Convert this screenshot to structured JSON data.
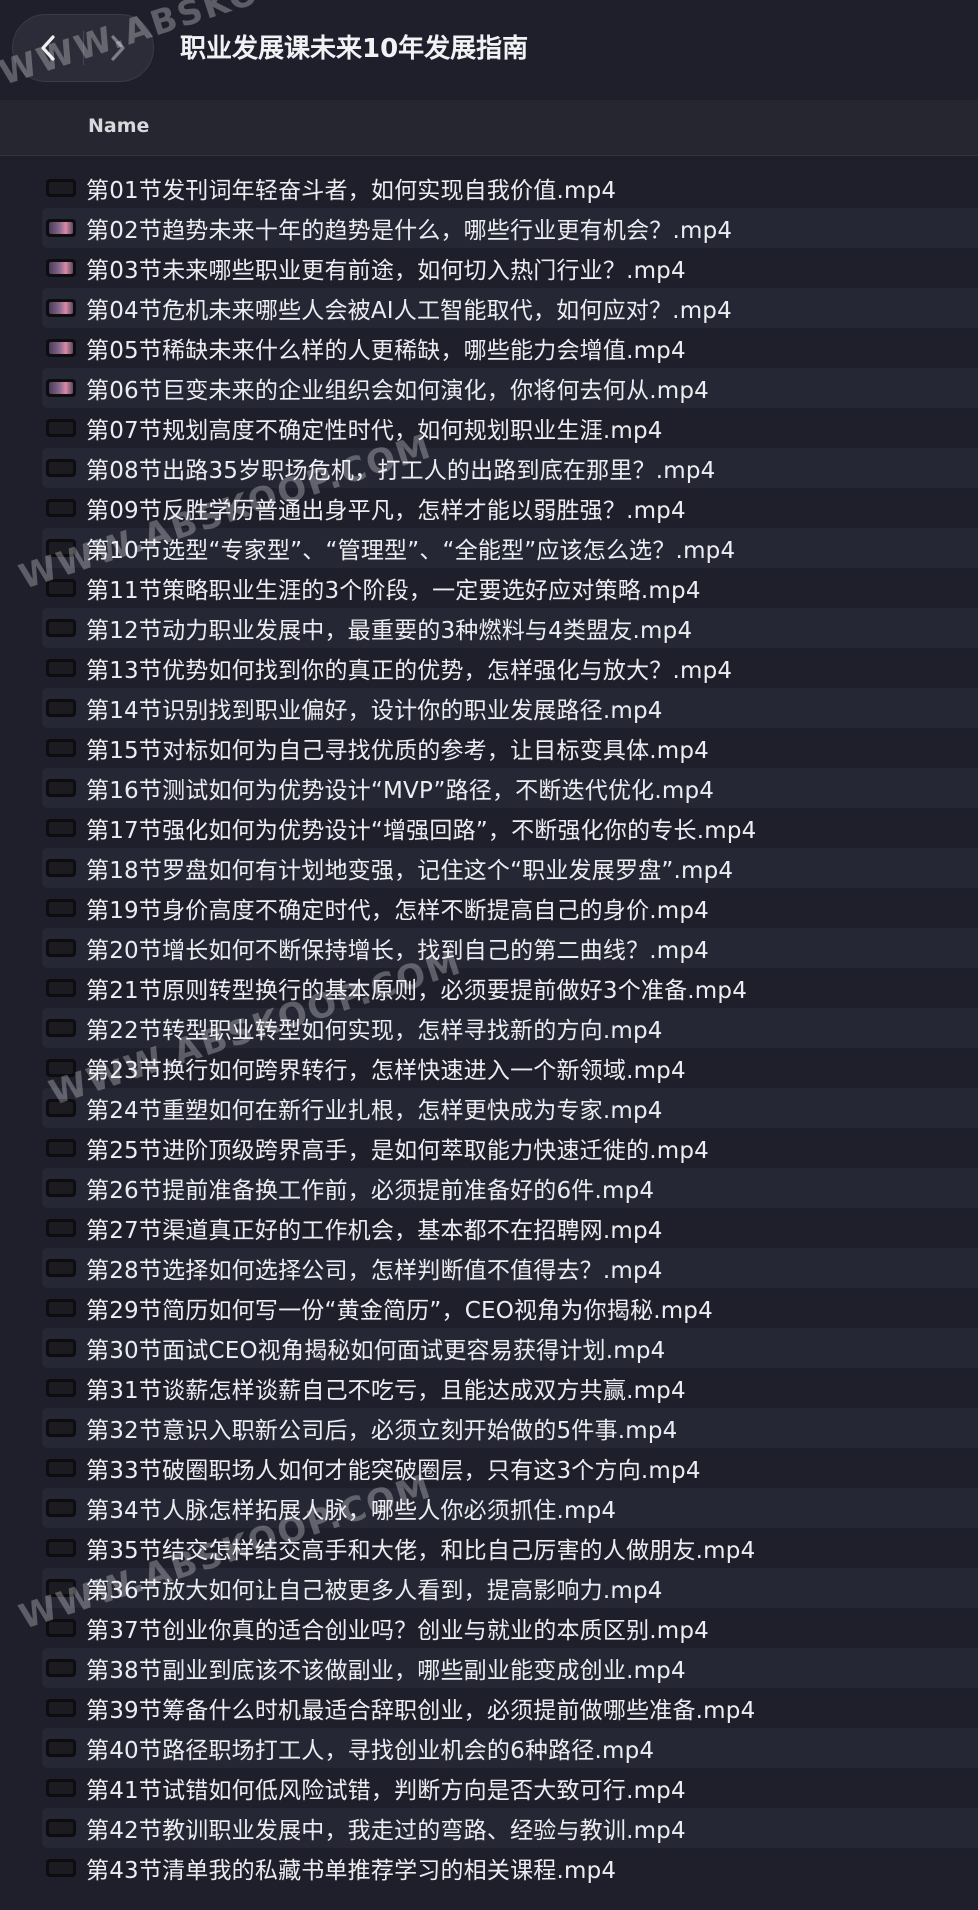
{
  "window": {
    "title": "职业发展课未来10年发展指南"
  },
  "columns": {
    "name": "Name"
  },
  "files": [
    {
      "name": "第01节发刊词年轻奋斗者，如何实现自我价值.mp4",
      "thumb": false
    },
    {
      "name": "第02节趋势未来十年的趋势是什么，哪些行业更有机会？.mp4",
      "thumb": true
    },
    {
      "name": "第03节未来哪些职业更有前途，如何切入热门行业？.mp4",
      "thumb": true
    },
    {
      "name": "第04节危机未来哪些人会被AI人工智能取代，如何应对？.mp4",
      "thumb": true
    },
    {
      "name": "第05节稀缺未来什么样的人更稀缺，哪些能力会增值.mp4",
      "thumb": true
    },
    {
      "name": "第06节巨变未来的企业组织会如何演化，你将何去何从.mp4",
      "thumb": true
    },
    {
      "name": "第07节规划高度不确定性时代，如何规划职业生涯.mp4",
      "thumb": false
    },
    {
      "name": "第08节出路35岁职场危机，打工人的出路到底在那里？.mp4",
      "thumb": false
    },
    {
      "name": "第09节反胜学历普通出身平凡，怎样才能以弱胜强？.mp4",
      "thumb": false
    },
    {
      "name": "第10节选型“专家型”、“管理型”、“全能型”应该怎么选？.mp4",
      "thumb": false
    },
    {
      "name": "第11节策略职业生涯的3个阶段，一定要选好应对策略.mp4",
      "thumb": false
    },
    {
      "name": "第12节动力职业发展中，最重要的3种燃料与4类盟友.mp4",
      "thumb": false
    },
    {
      "name": "第13节优势如何找到你的真正的优势，怎样强化与放大？.mp4",
      "thumb": false
    },
    {
      "name": "第14节识别找到职业偏好，设计你的职业发展路径.mp4",
      "thumb": false
    },
    {
      "name": "第15节对标如何为自己寻找优质的参考，让目标变具体.mp4",
      "thumb": false
    },
    {
      "name": "第16节测试如何为优势设计“MVP”路径，不断迭代优化.mp4",
      "thumb": false
    },
    {
      "name": "第17节强化如何为优势设计“增强回路”，不断强化你的专长.mp4",
      "thumb": false
    },
    {
      "name": "第18节罗盘如何有计划地变强，记住这个“职业发展罗盘”.mp4",
      "thumb": false
    },
    {
      "name": "第19节身价高度不确定时代，怎样不断提高自己的身价.mp4",
      "thumb": false
    },
    {
      "name": "第20节增长如何不断保持增长，找到自己的第二曲线？.mp4",
      "thumb": false
    },
    {
      "name": "第21节原则转型换行的基本原则，必须要提前做好3个准备.mp4",
      "thumb": false
    },
    {
      "name": "第22节转型职业转型如何实现，怎样寻找新的方向.mp4",
      "thumb": false
    },
    {
      "name": "第23节换行如何跨界转行，怎样快速进入一个新领域.mp4",
      "thumb": false
    },
    {
      "name": "第24节重塑如何在新行业扎根，怎样更快成为专家.mp4",
      "thumb": false
    },
    {
      "name": "第25节进阶顶级跨界高手，是如何萃取能力快速迁徙的.mp4",
      "thumb": false
    },
    {
      "name": "第26节提前准备换工作前，必须提前准备好的6件.mp4",
      "thumb": false
    },
    {
      "name": "第27节渠道真正好的工作机会，基本都不在招聘网.mp4",
      "thumb": false
    },
    {
      "name": "第28节选择如何选择公司，怎样判断值不值得去？.mp4",
      "thumb": false
    },
    {
      "name": "第29节简历如何写一份“黄金简历”，CEO视角为你揭秘.mp4",
      "thumb": false
    },
    {
      "name": "第30节面试CEO视角揭秘如何面试更容易获得计划.mp4",
      "thumb": false
    },
    {
      "name": "第31节谈薪怎样谈薪自己不吃亏，且能达成双方共赢.mp4",
      "thumb": false
    },
    {
      "name": "第32节意识入职新公司后，必须立刻开始做的5件事.mp4",
      "thumb": false
    },
    {
      "name": "第33节破圈职场人如何才能突破圈层，只有这3个方向.mp4",
      "thumb": false
    },
    {
      "name": "第34节人脉怎样拓展人脉，哪些人你必须抓住.mp4",
      "thumb": false
    },
    {
      "name": "第35节结交怎样结交高手和大佬，和比自己厉害的人做朋友.mp4",
      "thumb": false
    },
    {
      "name": "第36节放大如何让自己被更多人看到，提高影响力.mp4",
      "thumb": false
    },
    {
      "name": "第37节创业你真的适合创业吗？创业与就业的本质区别.mp4",
      "thumb": false
    },
    {
      "name": "第38节副业到底该不该做副业，哪些副业能变成创业.mp4",
      "thumb": false
    },
    {
      "name": "第39节筹备什么时机最适合辞职创业，必须提前做哪些准备.mp4",
      "thumb": false
    },
    {
      "name": "第40节路径职场打工人，寻找创业机会的6种路径.mp4",
      "thumb": false
    },
    {
      "name": "第41节试错如何低风险试错，判断方向是否大致可行.mp4",
      "thumb": false
    },
    {
      "name": "第42节教训职业发展中，我走过的弯路、经验与教训.mp4",
      "thumb": false
    },
    {
      "name": "第43节清单我的私藏书单推荐学习的相关课程.mp4",
      "thumb": false
    }
  ],
  "watermark": {
    "text": "WWW.ABSKOOP.COM"
  }
}
